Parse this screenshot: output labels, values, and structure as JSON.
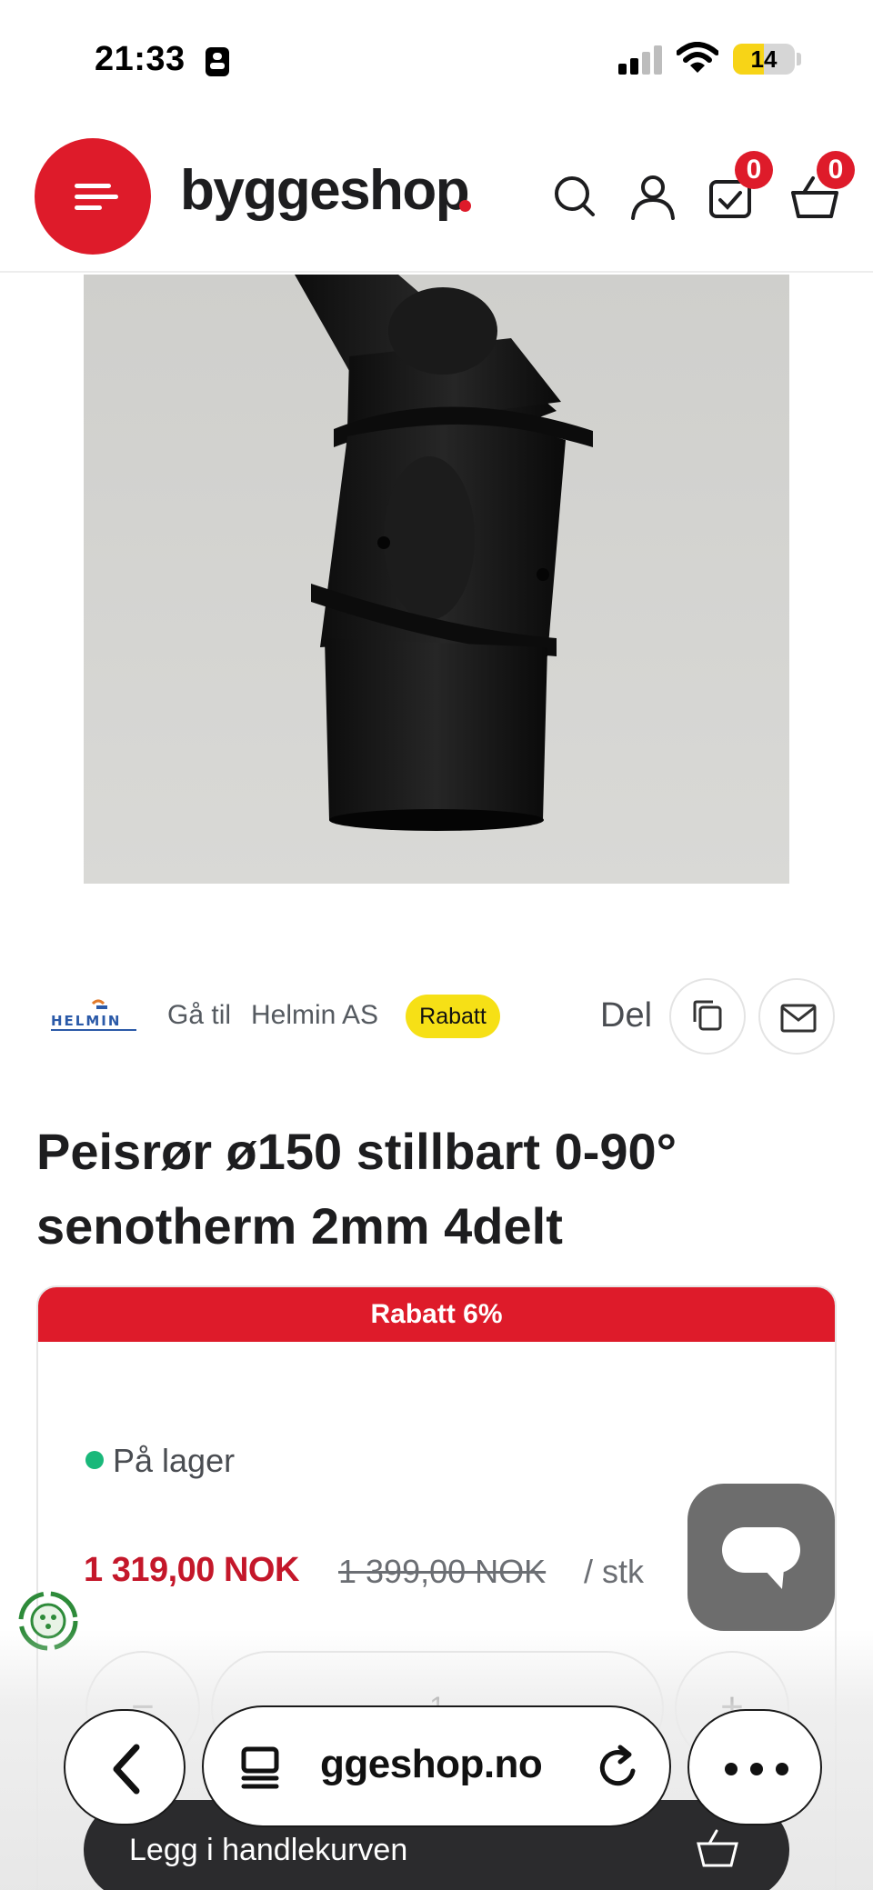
{
  "status_bar": {
    "time": "21:33",
    "battery_level": "14"
  },
  "header": {
    "logo_text": "byggeshop",
    "wishlist_count": "0",
    "cart_count": "0",
    "accent_color": "#de1b2a",
    "icons": [
      "menu-icon",
      "search-icon",
      "user-icon",
      "checklist-icon",
      "basket-icon"
    ]
  },
  "brand": {
    "logo_text": "HELMIN",
    "goto_label": "Gå til",
    "name": "Helmin AS",
    "tag": "Rabatt"
  },
  "share": {
    "label": "Del",
    "icons": [
      "copy-icon",
      "mail-icon"
    ]
  },
  "product": {
    "title": "Peisrør ø150 stillbart 0-90° senotherm 2mm 4delt",
    "discount_label": "Rabatt 6%",
    "stock_status": "På lager",
    "price_current": "1 319,00 NOK",
    "price_old": "1 399,00 NOK",
    "unit": "/ stk",
    "quantity": "1",
    "qty_minus": "−",
    "qty_plus": "+"
  },
  "add_to_cart": {
    "label": "Legg i handlekurven"
  },
  "safari": {
    "url": "ggeshop.no"
  }
}
